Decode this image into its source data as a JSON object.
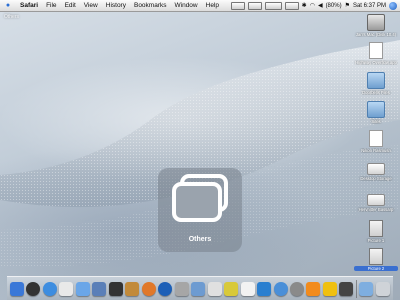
{
  "menubar": {
    "app_name": "Safari",
    "menus": [
      "File",
      "Edit",
      "View",
      "History",
      "Bookmarks",
      "Window",
      "Help"
    ],
    "battery": "(80%)",
    "clock": "Sat 6:37 PM"
  },
  "desktop": {
    "corner_label": "Others",
    "icons": [
      {
        "label": "Jan's Mac (Disk 10.4)"
      },
      {
        "label": "Highway Overflow.app"
      },
      {
        "label": "Doorbells Files"
      },
      {
        "label": "Sites"
      },
      {
        "label": "Nikon Rasmusn"
      },
      {
        "label": "Desktop Storage"
      },
      {
        "label": "Hervnitter Bassarp"
      },
      {
        "label": "Picture 1"
      },
      {
        "label": "Picture 2"
      }
    ]
  },
  "overlay": {
    "label": "Others"
  },
  "dock": {
    "items": [
      {
        "name": "finder",
        "color": "#3a78d8"
      },
      {
        "name": "dashboard",
        "color": "#333333"
      },
      {
        "name": "safari",
        "color": "#3d8de0"
      },
      {
        "name": "ical",
        "color": "#e9e9e9"
      },
      {
        "name": "itunes",
        "color": "#6aa6e8"
      },
      {
        "name": "iphoto",
        "color": "#5a7fb8"
      },
      {
        "name": "imovie",
        "color": "#333333"
      },
      {
        "name": "garageband",
        "color": "#c28a3a"
      },
      {
        "name": "firefox",
        "color": "#e0782a"
      },
      {
        "name": "quicktime",
        "color": "#1c5fb7"
      },
      {
        "name": "app-gray",
        "color": "#a6a6a6"
      },
      {
        "name": "wordpress",
        "color": "#6d9bd1"
      },
      {
        "name": "acrobat",
        "color": "#e0e0e0"
      },
      {
        "name": "stickies",
        "color": "#d8c93a"
      },
      {
        "name": "flickr",
        "color": "#f2f2f2"
      },
      {
        "name": "pen-app",
        "color": "#2a7fd0"
      },
      {
        "name": "chat",
        "color": "#4a8fd8"
      },
      {
        "name": "gray-disc",
        "color": "#8a8a8a"
      },
      {
        "name": "vlc",
        "color": "#f28b1c"
      },
      {
        "name": "yellow-app",
        "color": "#f0c010"
      },
      {
        "name": "warning-app",
        "color": "#444444"
      },
      {
        "name": "folder-stack",
        "color": "#7eaee0"
      },
      {
        "name": "trash",
        "color": "#cfd3d8"
      }
    ]
  }
}
